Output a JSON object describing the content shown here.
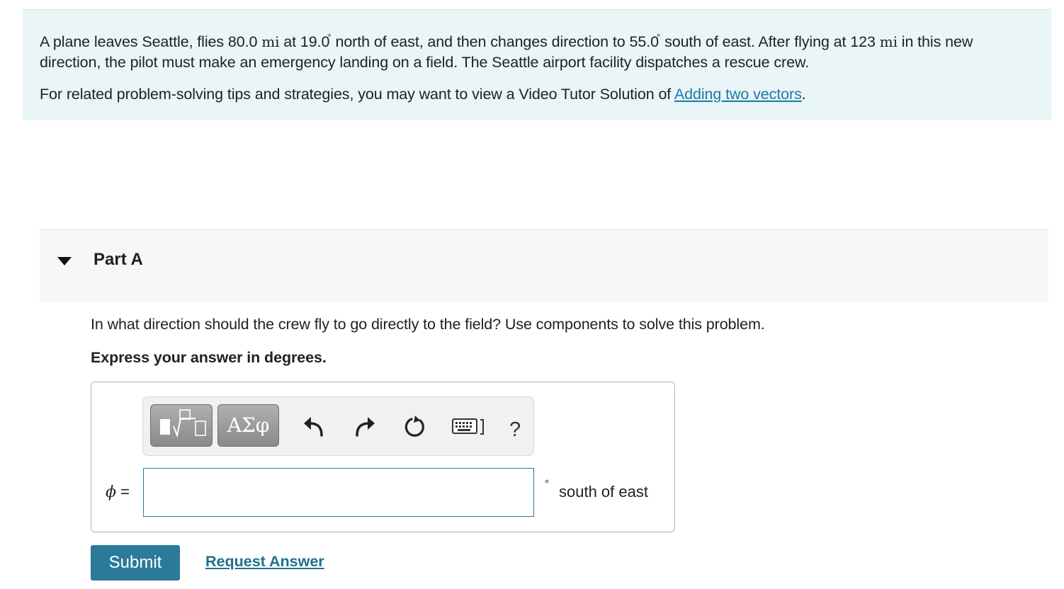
{
  "problem": {
    "line1_a": "A plane leaves Seattle, flies 80.0 ",
    "unit_mi_1": "mi",
    "line1_b": " at 19.0",
    "deg_1": "°",
    "line1_c": "north of east, and then changes direction to 55.0",
    "deg_2": "°",
    "line1_d": "south of east.  After flying at 123 ",
    "unit_mi_2": "mi",
    "line1_e": " in this new direction, the pilot must make an emergency landing on a field.  The Seattle airport facility dispatches a rescue crew.",
    "tips_prefix": "For related problem-solving tips and strategies, you may want to view a Video Tutor Solution of ",
    "tips_link": "Adding two vectors",
    "tips_suffix": "."
  },
  "part": {
    "title": "Part A",
    "question": "In what direction should the crew fly to go directly to the field?  Use components to solve this problem.",
    "instruction": "Express your answer in degrees."
  },
  "toolbar": {
    "greek_label": "ΑΣφ",
    "help_label": "?"
  },
  "answer": {
    "variable": "ϕ",
    "equals": " =",
    "value": "",
    "unit_degree": "°",
    "unit_text": "south of east"
  },
  "actions": {
    "submit_label": "Submit",
    "request_answer_label": "Request Answer"
  },
  "colors": {
    "problem_bg": "#e9f5f7",
    "accent": "#2c7a9a",
    "link": "#1a7aa5"
  }
}
